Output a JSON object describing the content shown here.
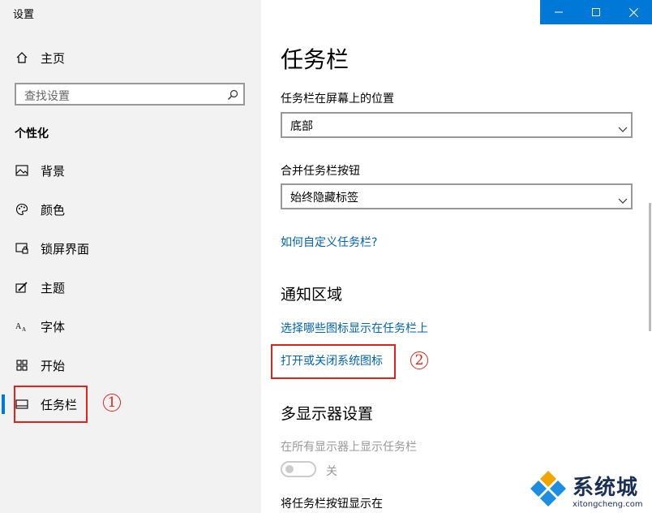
{
  "window": {
    "title": "设置"
  },
  "controls": {
    "minimize": "—",
    "maximize": "☐",
    "close": "✕"
  },
  "sidebar": {
    "home_label": "主页",
    "search_placeholder": "查找设置",
    "category": "个性化",
    "items": [
      {
        "label": "背景",
        "icon": "picture-icon"
      },
      {
        "label": "颜色",
        "icon": "palette-icon"
      },
      {
        "label": "锁屏界面",
        "icon": "lock-screen-icon"
      },
      {
        "label": "主题",
        "icon": "theme-brush-icon"
      },
      {
        "label": "字体",
        "icon": "font-icon"
      },
      {
        "label": "开始",
        "icon": "start-grid-icon"
      },
      {
        "label": "任务栏",
        "icon": "taskbar-icon",
        "selected": true
      }
    ]
  },
  "main": {
    "title": "任务栏",
    "position_label": "任务栏在屏幕上的位置",
    "position_value": "底部",
    "combine_label": "合并任务栏按钮",
    "combine_value": "始终隐藏标签",
    "customize_link": "如何自定义任务栏?",
    "notification_title": "通知区域",
    "select_icons_link": "选择哪些图标显示在任务栏上",
    "system_icons_link": "打开或关闭系统图标",
    "multi_display_title": "多显示器设置",
    "show_all_label": "在所有显示器上显示任务栏",
    "show_all_state": "关",
    "show_buttons_label": "将任务栏按钮显示在"
  },
  "annotations": {
    "marker_1": "1",
    "marker_2": "2",
    "color": "#e2231a"
  },
  "watermark": {
    "name": "系统城",
    "url": "xitongcheng.com"
  },
  "colors": {
    "accent": "#0078d7",
    "link": "#0063b1",
    "sidebar_bg": "#f2f2f2"
  }
}
